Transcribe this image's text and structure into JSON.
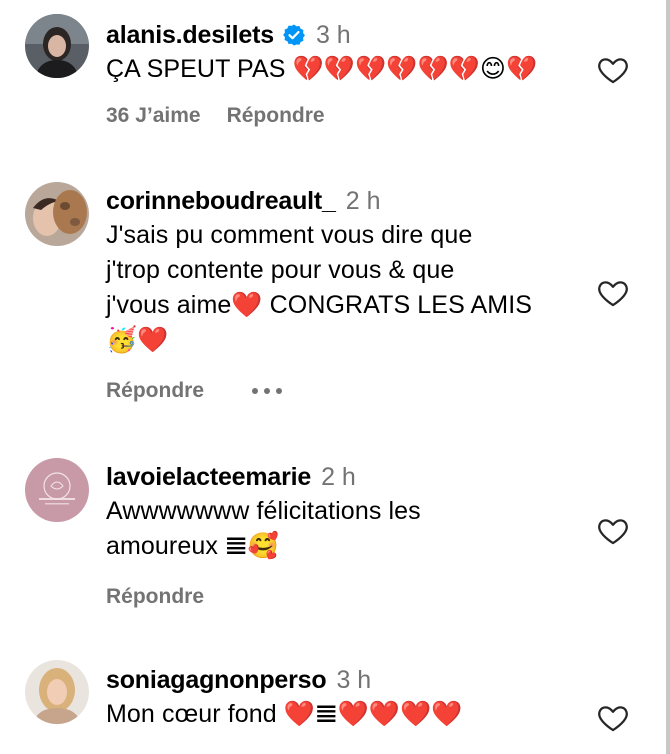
{
  "comments": [
    {
      "username": "alanis.desilets",
      "time": "3 h",
      "text": "ÇA SPEUT PAS 💔💔💔💔💔💔😊💔",
      "likes": "36 J’aime",
      "reply": "Répondre"
    },
    {
      "username": "corinneboudreault_",
      "time": "2 h",
      "lines": [
        "J'sais pu comment vous dire que",
        "j'trop contente pour vous & que",
        "j'vous aime❤️ CONGRATS LES AMIS",
        "🥳❤️"
      ],
      "reply": "Répondre"
    },
    {
      "username": "lavoielacteemarie",
      "time": "2 h",
      "lines": [
        "Awwwwwww félicitations les",
        "amoureux 𝌆🥰"
      ],
      "reply": "Répondre"
    },
    {
      "username": "soniagagnonperso",
      "time": "3 h",
      "text": "Mon cœur fond ❤️𝌆❤️❤️❤️❤️"
    }
  ],
  "colors": {
    "verified": "#0095f6",
    "secondary_text": "#737373"
  },
  "icons": {
    "like": "heart-outline-icon",
    "verified": "verified-badge-icon",
    "more": "more-options-icon"
  }
}
